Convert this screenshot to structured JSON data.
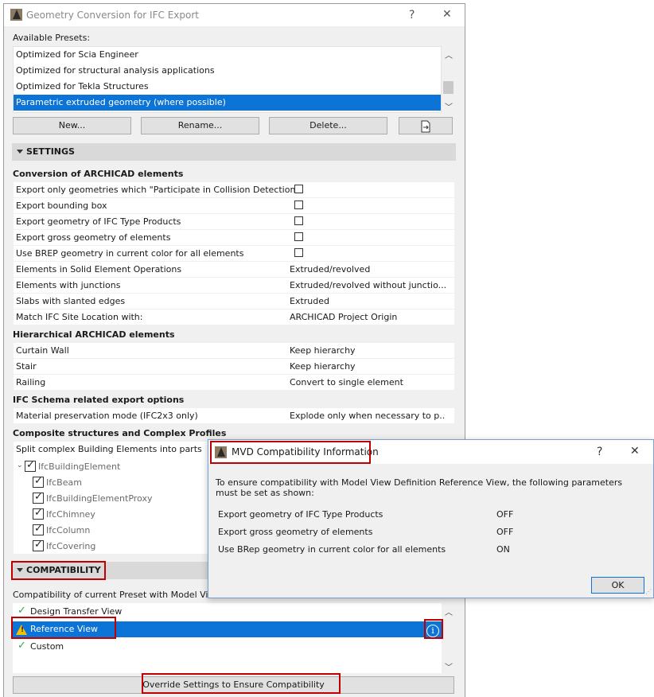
{
  "window": {
    "title": "Geometry Conversion for IFC Export",
    "help_label": "?",
    "close_label": "✕"
  },
  "presets": {
    "header": "Available Presets:",
    "items": [
      "Optimized for Scia Engineer",
      "Optimized for structural analysis applications",
      "Optimized for Tekla Structures",
      "Parametric extruded geometry (where possible)"
    ],
    "selected_index": 3,
    "buttons": {
      "new": "New...",
      "rename": "Rename...",
      "delete": "Delete..."
    }
  },
  "settings": {
    "header": "SETTINGS",
    "groups": {
      "conversion": {
        "title": "Conversion of ARCHICAD elements",
        "rows": [
          {
            "label": "Export only geometries which \"Participate in Collision Detection\"",
            "type": "checkbox",
            "checked": false
          },
          {
            "label": "Export bounding box",
            "type": "checkbox",
            "checked": false
          },
          {
            "label": "Export geometry of IFC Type Products",
            "type": "checkbox",
            "checked": false
          },
          {
            "label": "Export gross geometry of elements",
            "type": "checkbox",
            "checked": false
          },
          {
            "label": "Use BREP geometry in current color for all elements",
            "type": "checkbox",
            "checked": false
          },
          {
            "label": "Elements in Solid Element Operations",
            "value": "Extruded/revolved"
          },
          {
            "label": "Elements with junctions",
            "value": "Extruded/revolved without junctio..."
          },
          {
            "label": "Slabs with slanted edges",
            "value": "Extruded"
          },
          {
            "label": "Match IFC Site Location with:",
            "value": "ARCHICAD Project Origin"
          }
        ]
      },
      "hierarchical": {
        "title": "Hierarchical ARCHICAD elements",
        "rows": [
          {
            "label": "Curtain Wall",
            "value": "Keep hierarchy"
          },
          {
            "label": "Stair",
            "value": "Keep hierarchy"
          },
          {
            "label": "Railing",
            "value": "Convert to single element"
          }
        ]
      },
      "schema": {
        "title": "IFC Schema related export options",
        "rows": [
          {
            "label": "Material preservation mode (IFC2x3 only)",
            "value": "Explode only when necessary to p..."
          }
        ]
      },
      "composite": {
        "title": "Composite structures and Complex Profiles",
        "split_label": "Split complex Building Elements into parts",
        "tree_root": "IfcBuildingElement",
        "tree_children": [
          "IfcBeam",
          "IfcBuildingElementProxy",
          "IfcChimney",
          "IfcColumn",
          "IfcCovering"
        ]
      }
    }
  },
  "compatibility": {
    "header": "COMPATIBILITY",
    "caption": "Compatibility of current Preset with Model View",
    "views": [
      {
        "label": "Design Transfer View",
        "status": "ok"
      },
      {
        "label": "Reference View",
        "status": "warning"
      },
      {
        "label": "Custom",
        "status": "ok"
      }
    ],
    "override_button": "Override Settings to Ensure Compatibility"
  },
  "mvd_dialog": {
    "title": "MVD Compatibility Information",
    "help_label": "?",
    "close_label": "✕",
    "message": "To ensure compatibility with Model View Definition Reference View, the following parameters must be set as shown:",
    "params": [
      {
        "name": "Export geometry of IFC Type Products",
        "value": "OFF"
      },
      {
        "name": "Export gross geometry of elements",
        "value": "OFF"
      },
      {
        "name": "Use BRep geometry in current color for all elements",
        "value": "ON"
      }
    ],
    "ok_label": "OK"
  },
  "colors": {
    "selection": "#0b74d6",
    "highlight_frame": "#c00000",
    "ok_check": "#2fa84f",
    "warning": "#f2c200"
  }
}
